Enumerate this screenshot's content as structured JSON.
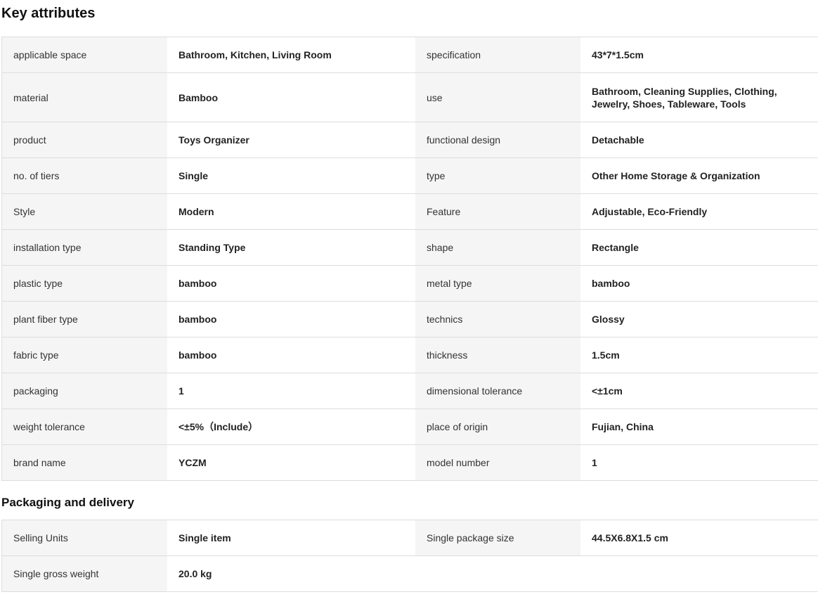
{
  "key_attributes": {
    "title": "Key attributes",
    "rows": [
      [
        {
          "label": "applicable space",
          "value": "Bathroom, Kitchen, Living Room"
        },
        {
          "label": "specification",
          "value": "43*7*1.5cm"
        }
      ],
      [
        {
          "label": "material",
          "value": "Bamboo"
        },
        {
          "label": "use",
          "value": "Bathroom, Cleaning Supplies, Clothing, Jewelry, Shoes, Tableware, Tools"
        }
      ],
      [
        {
          "label": "product",
          "value": "Toys Organizer"
        },
        {
          "label": "functional design",
          "value": "Detachable"
        }
      ],
      [
        {
          "label": "no. of tiers",
          "value": "Single"
        },
        {
          "label": "type",
          "value": "Other Home Storage & Organization"
        }
      ],
      [
        {
          "label": "Style",
          "value": "Modern"
        },
        {
          "label": "Feature",
          "value": "Adjustable, Eco-Friendly"
        }
      ],
      [
        {
          "label": "installation type",
          "value": "Standing Type"
        },
        {
          "label": "shape",
          "value": "Rectangle"
        }
      ],
      [
        {
          "label": "plastic type",
          "value": "bamboo"
        },
        {
          "label": "metal type",
          "value": "bamboo"
        }
      ],
      [
        {
          "label": "plant fiber type",
          "value": "bamboo"
        },
        {
          "label": "technics",
          "value": "Glossy"
        }
      ],
      [
        {
          "label": "fabric type",
          "value": "bamboo"
        },
        {
          "label": "thickness",
          "value": "1.5cm"
        }
      ],
      [
        {
          "label": "packaging",
          "value": "1"
        },
        {
          "label": "dimensional tolerance",
          "value": "<±1cm"
        }
      ],
      [
        {
          "label": "weight tolerance",
          "value": "<±5%（Include）"
        },
        {
          "label": "place of origin",
          "value": "Fujian, China"
        }
      ],
      [
        {
          "label": "brand name",
          "value": "YCZM"
        },
        {
          "label": "model number",
          "value": "1"
        }
      ]
    ]
  },
  "packaging_delivery": {
    "title": "Packaging and delivery",
    "rows": [
      [
        {
          "label": "Selling Units",
          "value": "Single item"
        },
        {
          "label": "Single package size",
          "value": "44.5X6.8X1.5 cm"
        }
      ],
      [
        {
          "label": "Single gross weight",
          "value": "20.0 kg"
        },
        {
          "label": "",
          "value": ""
        }
      ]
    ]
  }
}
